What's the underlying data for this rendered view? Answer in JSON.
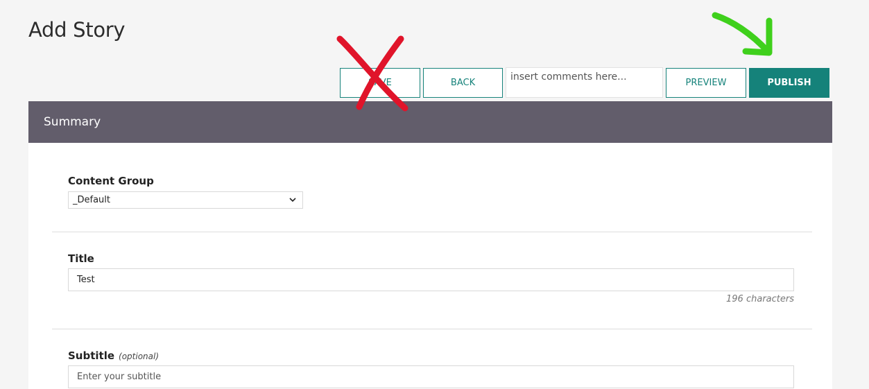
{
  "page": {
    "title": "Add Story"
  },
  "toolbar": {
    "save_label": "SAVE",
    "back_label": "BACK",
    "comments_placeholder": "insert comments here...",
    "preview_label": "PREVIEW",
    "publish_label": "PUBLISH"
  },
  "summary": {
    "title": "Summary"
  },
  "form": {
    "content_group": {
      "label": "Content Group",
      "selected": "_Default"
    },
    "title": {
      "label": "Title",
      "value": "Test",
      "char_count": "196 characters"
    },
    "subtitle": {
      "label": "Subtitle",
      "optional": "(optional)",
      "placeholder": "Enter your subtitle"
    }
  },
  "colors": {
    "accent": "#15827a",
    "summary_bar": "#625d6b",
    "annotation_red": "#e0142a",
    "annotation_green": "#3fd01c"
  },
  "annotations": {
    "cross": "red-x-mark",
    "arrow": "green-arrow"
  }
}
